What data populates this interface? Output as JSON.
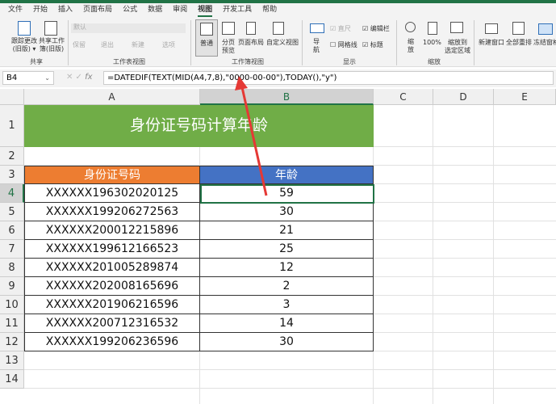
{
  "menu": {
    "tabs": [
      "文件",
      "开始",
      "插入",
      "页面布局",
      "公式",
      "数据",
      "审阅",
      "视图",
      "开发工具",
      "帮助"
    ],
    "active": "视图"
  },
  "ribbon": {
    "share": {
      "track": "跟踪更改",
      "track2": "(旧版) ▾",
      "shared": "共享工作",
      "shared2": "簿(旧版)",
      "group": "共享"
    },
    "sheetview": {
      "dropdown": "默认",
      "keep": "保留",
      "exit": "退出",
      "new": "新建",
      "options": "选项",
      "group": "工作表视图"
    },
    "workbookview": {
      "normal": "普通",
      "pagebreak": "分页",
      "pagebreak2": "预览",
      "pagelayout": "页面布局",
      "custom": "自定义视图",
      "group": "工作簿视图"
    },
    "show": {
      "nav": "导",
      "nav2": "航",
      "ruler": "直尺",
      "formulabar": "编辑栏",
      "gridlines": "网格线",
      "headings": "标题",
      "group": "显示"
    },
    "zoom": {
      "zoom": "缩",
      "zoom2": "放",
      "p100": "100%",
      "sel": "缩放到",
      "sel2": "选定区域",
      "group": "缩放"
    },
    "window": {
      "newwin": "新建窗口",
      "arrange": "全部重排",
      "freeze": "冻结窗格"
    }
  },
  "formula_bar": {
    "name_box": "B4",
    "fx": "fx",
    "formula": "=DATEDIF(TEXT(MID(A4,7,8),\"0000-00-00\"),TODAY(),\"y\")"
  },
  "columns": [
    "A",
    "B",
    "C",
    "D",
    "E"
  ],
  "rows": [
    "1",
    "2",
    "3",
    "4",
    "5",
    "6",
    "7",
    "8",
    "9",
    "10",
    "11",
    "12",
    "13",
    "14"
  ],
  "sheet": {
    "title": "身份证号码计算年龄",
    "headers": [
      "身份证号码",
      "年龄"
    ],
    "data": [
      [
        "XXXXXX196302020125",
        "59"
      ],
      [
        "XXXXXX199206272563",
        "30"
      ],
      [
        "XXXXXX200012215896",
        "21"
      ],
      [
        "XXXXXX199612166523",
        "25"
      ],
      [
        "XXXXXX201005289874",
        "12"
      ],
      [
        "XXXXXX202008165696",
        "2"
      ],
      [
        "XXXXXX201906216596",
        "3"
      ],
      [
        "XXXXXX200712316532",
        "14"
      ],
      [
        "XXXXXX199206236596",
        "30"
      ]
    ]
  },
  "colors": {
    "title_bg": "#70AD47",
    "header_a": "#ED7D31",
    "header_b": "#4472C4",
    "arrow": "#E53935",
    "selection": "#217346"
  }
}
